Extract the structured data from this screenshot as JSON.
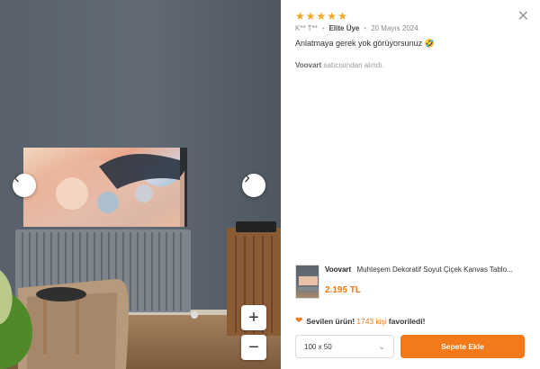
{
  "review": {
    "rating": 5,
    "stars": [
      "★",
      "★",
      "★",
      "★",
      "★"
    ],
    "author": "K** T**",
    "badge": "Elite Üye",
    "date": "20 Mayıs 2024",
    "comment": "Anlatmaya gerek yok görüyorsunuz 🤣",
    "seller_name": "Voovart",
    "seller_suffix": "satıcısından alındı."
  },
  "product": {
    "brand": "Voovart",
    "title": "Muhteşem Dekoratif Soyut Çiçek Kanvas Tablo...",
    "price": "2.195 TL"
  },
  "favorites": {
    "prefix": "Sevilen ürün!",
    "count": "1743 kişi",
    "suffix": "favoriledi!"
  },
  "size_select": {
    "value": "100 x 50"
  },
  "cart": {
    "label": "Sepete Ekle"
  },
  "zoom": {
    "in_label": "+",
    "out_label": "−"
  },
  "icons": {
    "close": "close-icon",
    "prev": "chevron-left-icon",
    "next": "chevron-right-icon",
    "heart": "heart-icon",
    "dropdown": "chevron-down-icon"
  },
  "colors": {
    "accent": "#f27a1a",
    "star": "#f5a623"
  }
}
